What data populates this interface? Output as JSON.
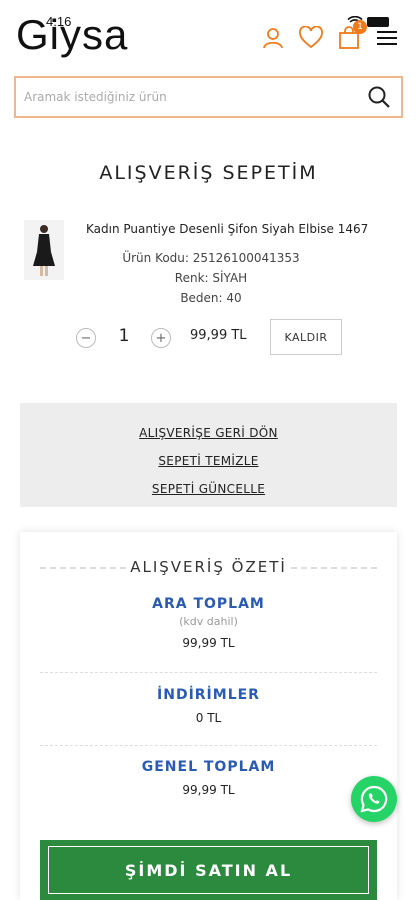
{
  "status_bar": {
    "time": "4:16"
  },
  "header": {
    "logo": "Giysa",
    "cart_count": "1",
    "icons": [
      "user-icon",
      "heart-icon",
      "shopping-bag-icon",
      "menu-icon"
    ],
    "accent_color": "#f27a1a"
  },
  "search": {
    "placeholder": "Aramak istediğiniz ürün"
  },
  "page_title": "ALIŞVERİŞ SEPETİM",
  "product": {
    "name": "Kadın Puantiye Desenli Şifon Siyah Elbise 1467",
    "code": "Ürün Kodu: 25126100041353",
    "color": "Renk: SİYAH",
    "size": "Beden: 40",
    "quantity": "1",
    "price": "99,99 TL",
    "remove_label": "KALDIR"
  },
  "actions": {
    "back": "ALIŞVERİŞE GERİ DÖN",
    "clear": "SEPETİ TEMİZLE",
    "update": "SEPETİ GÜNCELLE"
  },
  "summary": {
    "title": "ALIŞVERİŞ ÖZETİ",
    "subtotal_label": "ARA TOPLAM",
    "subtotal_note": "(kdv dahil)",
    "subtotal_value": "99,99 TL",
    "discount_label": "İNDİRİMLER",
    "discount_value": "0 TL",
    "total_label": "GENEL TOPLAM",
    "total_value": "99,99 TL",
    "buy_label": "ŞİMDİ SATIN AL",
    "label_color": "#2a5bb3",
    "buy_color": "#2b8a3e"
  }
}
